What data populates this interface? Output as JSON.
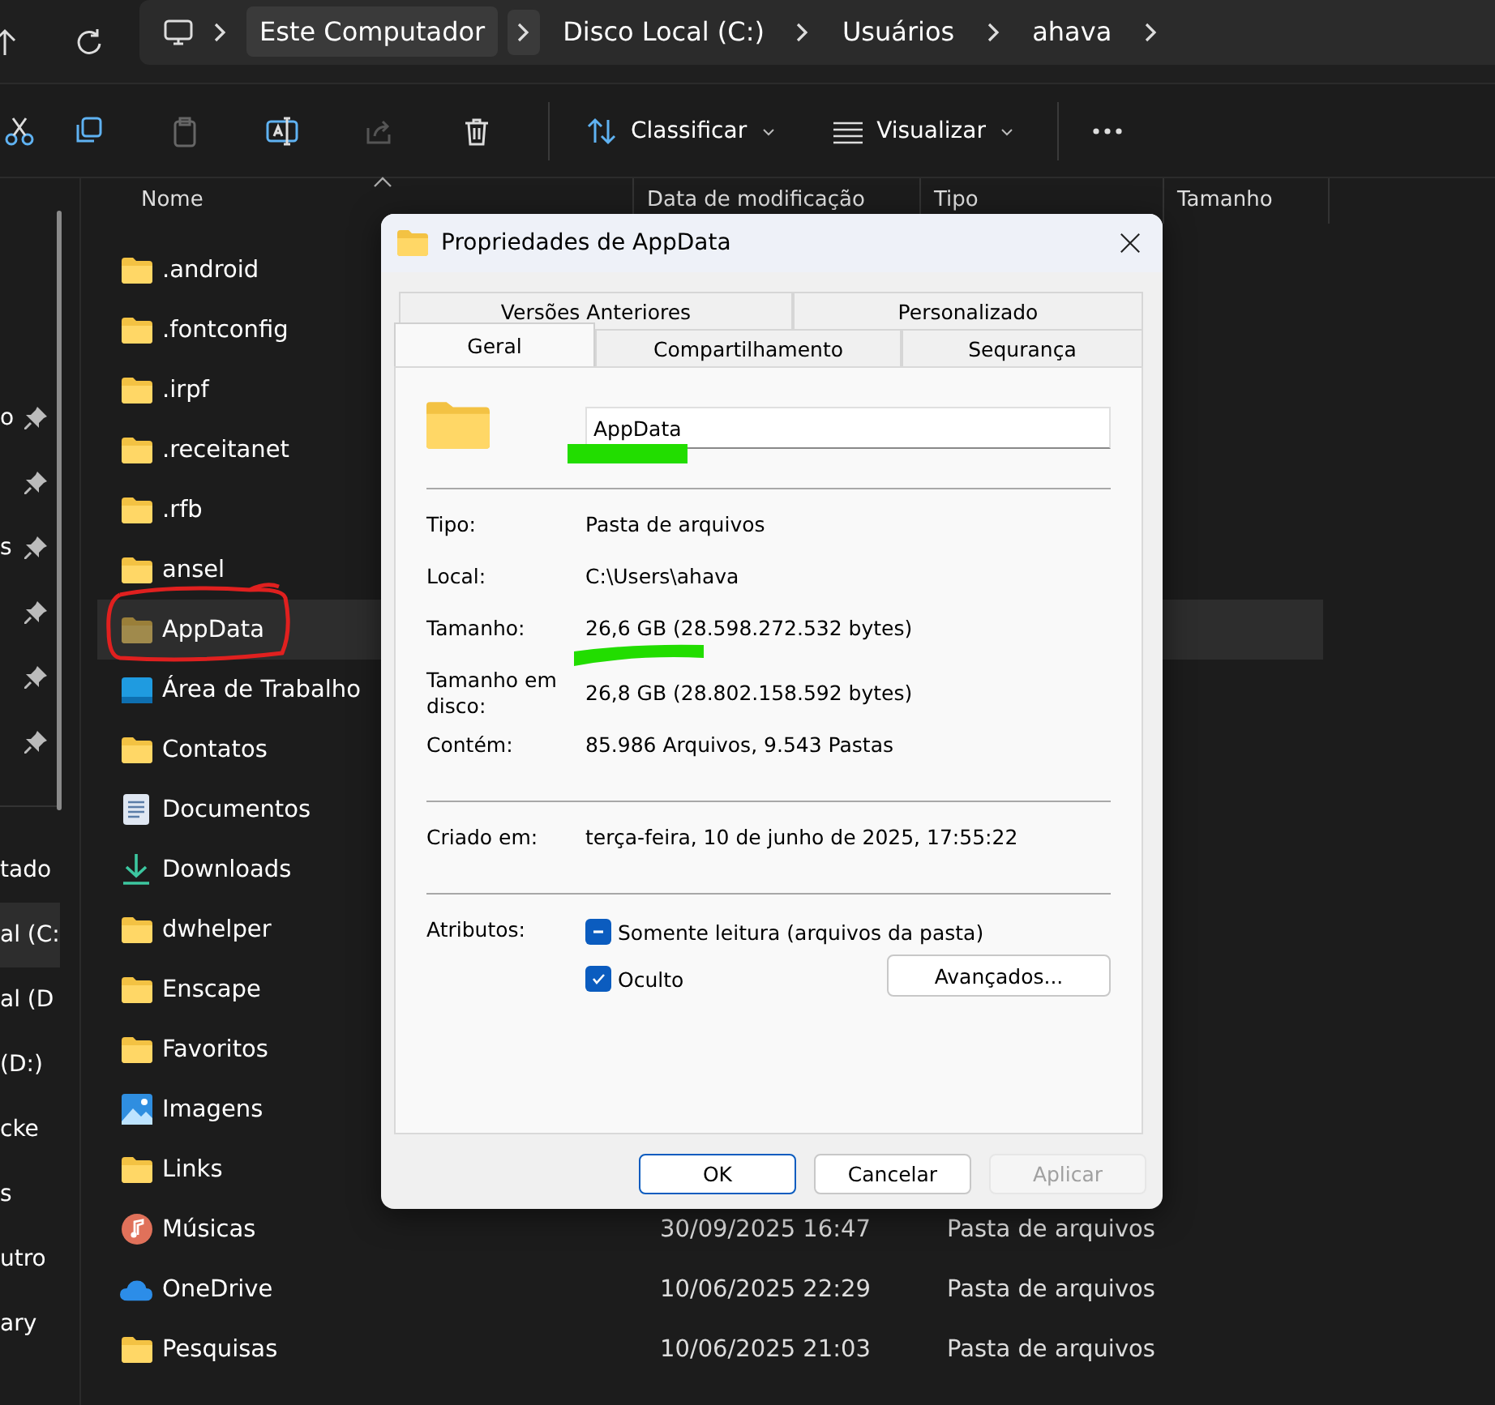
{
  "breadcrumb": [
    {
      "label": "Este Computador",
      "selected": true
    },
    {
      "label": "Disco Local (C:)",
      "selected": false
    },
    {
      "label": "Usuários",
      "selected": false
    },
    {
      "label": "ahava",
      "selected": false
    }
  ],
  "toolbar": {
    "sort_label": "Classificar",
    "view_label": "Visualizar"
  },
  "sidebar": {
    "items": [
      {
        "label": "o",
        "pinned": true,
        "selected": false
      },
      {
        "pinned": true,
        "selected": false
      },
      {
        "label": "s",
        "pinned": true,
        "selected": false
      },
      {
        "pinned": true,
        "selected": false
      },
      {
        "pinned": true,
        "selected": false
      },
      {
        "pinned": true,
        "selected": false
      },
      {
        "label": "tado",
        "pinned": false,
        "selected": false
      },
      {
        "label": "al (C:",
        "pinned": false,
        "selected": true
      },
      {
        "label": "al (D",
        "pinned": false,
        "selected": false
      },
      {
        "label": "(D:)",
        "pinned": false,
        "selected": false
      },
      {
        "label": "cke",
        "pinned": false,
        "selected": false
      },
      {
        "label": "s",
        "pinned": false,
        "selected": false
      },
      {
        "label": "utro",
        "pinned": false,
        "selected": false
      },
      {
        "label": "ary",
        "pinned": false,
        "selected": false
      }
    ]
  },
  "columns": [
    {
      "label": "Nome",
      "sorted": true
    },
    {
      "label": "Data de modificação",
      "sorted": false
    },
    {
      "label": "Tipo",
      "sorted": false
    },
    {
      "label": "Tamanho",
      "sorted": false
    }
  ],
  "files": [
    {
      "name": ".android",
      "kind": "folder",
      "hidden": false,
      "selected": false
    },
    {
      "name": ".fontconfig",
      "kind": "folder",
      "hidden": false,
      "selected": false
    },
    {
      "name": ".irpf",
      "kind": "folder",
      "hidden": false,
      "selected": false
    },
    {
      "name": ".receitanet",
      "kind": "folder",
      "hidden": false,
      "selected": false
    },
    {
      "name": ".rfb",
      "kind": "folder",
      "hidden": false,
      "selected": false
    },
    {
      "name": "ansel",
      "kind": "folder",
      "hidden": false,
      "selected": false
    },
    {
      "name": "AppData",
      "kind": "folder",
      "hidden": true,
      "selected": true
    },
    {
      "name": "Área de Trabalho",
      "kind": "desktop",
      "hidden": false,
      "selected": false
    },
    {
      "name": "Contatos",
      "kind": "folder",
      "hidden": false,
      "selected": false
    },
    {
      "name": "Documentos",
      "kind": "document",
      "hidden": false,
      "selected": false
    },
    {
      "name": "Downloads",
      "kind": "download",
      "hidden": false,
      "selected": false
    },
    {
      "name": "dwhelper",
      "kind": "folder",
      "hidden": false,
      "selected": false
    },
    {
      "name": "Enscape",
      "kind": "folder",
      "hidden": false,
      "selected": false
    },
    {
      "name": "Favoritos",
      "kind": "folder",
      "hidden": false,
      "selected": false
    },
    {
      "name": "Imagens",
      "kind": "image",
      "hidden": false,
      "selected": false
    },
    {
      "name": "Links",
      "kind": "folder",
      "hidden": false,
      "selected": false
    },
    {
      "name": "Músicas",
      "kind": "music",
      "hidden": false,
      "selected": false,
      "date": "30/09/2025 16:47",
      "type": "Pasta de arquivos"
    },
    {
      "name": "OneDrive",
      "kind": "cloud",
      "hidden": false,
      "selected": false,
      "date": "10/06/2025 22:29",
      "type": "Pasta de arquivos"
    },
    {
      "name": "Pesquisas",
      "kind": "folder",
      "hidden": false,
      "selected": false,
      "date": "10/06/2025 21:03",
      "type": "Pasta de arquivos"
    }
  ],
  "dialog": {
    "title": "Propriedades de AppData",
    "back_tabs": [
      {
        "label": "Versões Anteriores",
        "selected": false
      },
      {
        "label": "Personalizado",
        "selected": false
      }
    ],
    "front_tabs": [
      {
        "label": "Geral",
        "selected": true
      },
      {
        "label": "Compartilhamento",
        "selected": false
      },
      {
        "label": "Sequrança",
        "selected": false
      }
    ],
    "name_value": "AppData",
    "sections": [
      [
        {
          "label": "Tipo:",
          "value": "Pasta de arquivos"
        },
        {
          "label": "Local:",
          "value": "C:\\Users\\ahava"
        },
        {
          "label": "Tamanho:",
          "value": "26,6 GB (28.598.272.532 bytes)"
        },
        {
          "label": "Tamanho em disco:",
          "value": "26,8 GB (28.802.158.592 bytes)"
        },
        {
          "label": "Contém:",
          "value": "85.986 Arquivos, 9.543 Pastas"
        }
      ],
      [
        {
          "label": "Criado em:",
          "value": "terça-feira, 10 de junho de 2025, 17:55:22"
        }
      ]
    ],
    "attributes_label": "Atributos:",
    "attributes": [
      {
        "label": "Somente leitura (arquivos da pasta)",
        "checked": true,
        "indeterminate": true
      },
      {
        "label": "Oculto",
        "checked": true,
        "indeterminate": false
      }
    ],
    "advanced_button": "Avançados...",
    "buttons": [
      {
        "label": "OK",
        "default": true,
        "disabled": false
      },
      {
        "label": "Cancelar",
        "default": false,
        "disabled": false
      },
      {
        "label": "Aplicar",
        "default": false,
        "disabled": true
      }
    ]
  }
}
